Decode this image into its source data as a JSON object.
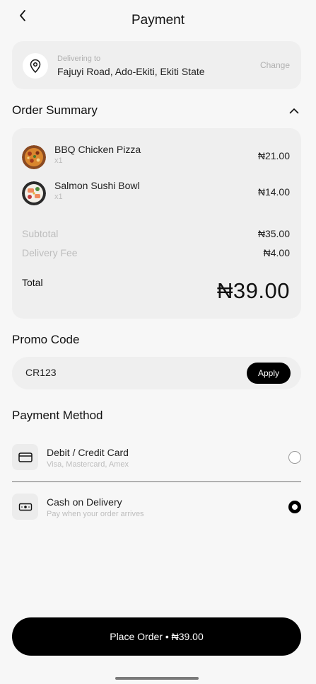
{
  "header": {
    "title": "Payment"
  },
  "delivery": {
    "label": "Delivering to",
    "address": "Fajuyi Road, Ado-Ekiti, Ekiti State",
    "change_label": "Change"
  },
  "order_summary": {
    "title": "Order Summary",
    "items": [
      {
        "name": "BBQ Chicken Pizza",
        "qty": "x1",
        "price": "₦21.00",
        "icon": "pizza-image"
      },
      {
        "name": "Salmon Sushi Bowl",
        "qty": "x1",
        "price": "₦14.00",
        "icon": "sushi-bowl-image"
      }
    ],
    "subtotal_label": "Subtotal",
    "subtotal_value": "₦35.00",
    "delivery_fee_label": "Delivery Fee",
    "delivery_fee_value": "₦4.00",
    "total_label": "Total",
    "total_value": "₦39.00"
  },
  "promo": {
    "title": "Promo Code",
    "value": "CR123",
    "apply_label": "Apply"
  },
  "payment_method": {
    "title": "Payment Method",
    "options": [
      {
        "title": "Debit / Credit Card",
        "subtitle": "Visa, Mastercard, Amex",
        "icon": "credit-card-icon",
        "selected": false
      },
      {
        "title": "Cash on Delivery",
        "subtitle": "Pay when your order arrives",
        "icon": "cash-icon",
        "selected": true
      }
    ]
  },
  "place_order": {
    "label": "Place Order • ₦39.00"
  },
  "colors": {
    "primary": "#000000",
    "card_bg": "#efefef",
    "page_bg": "#f7f7f7",
    "muted_text": "#bdbdbd"
  }
}
